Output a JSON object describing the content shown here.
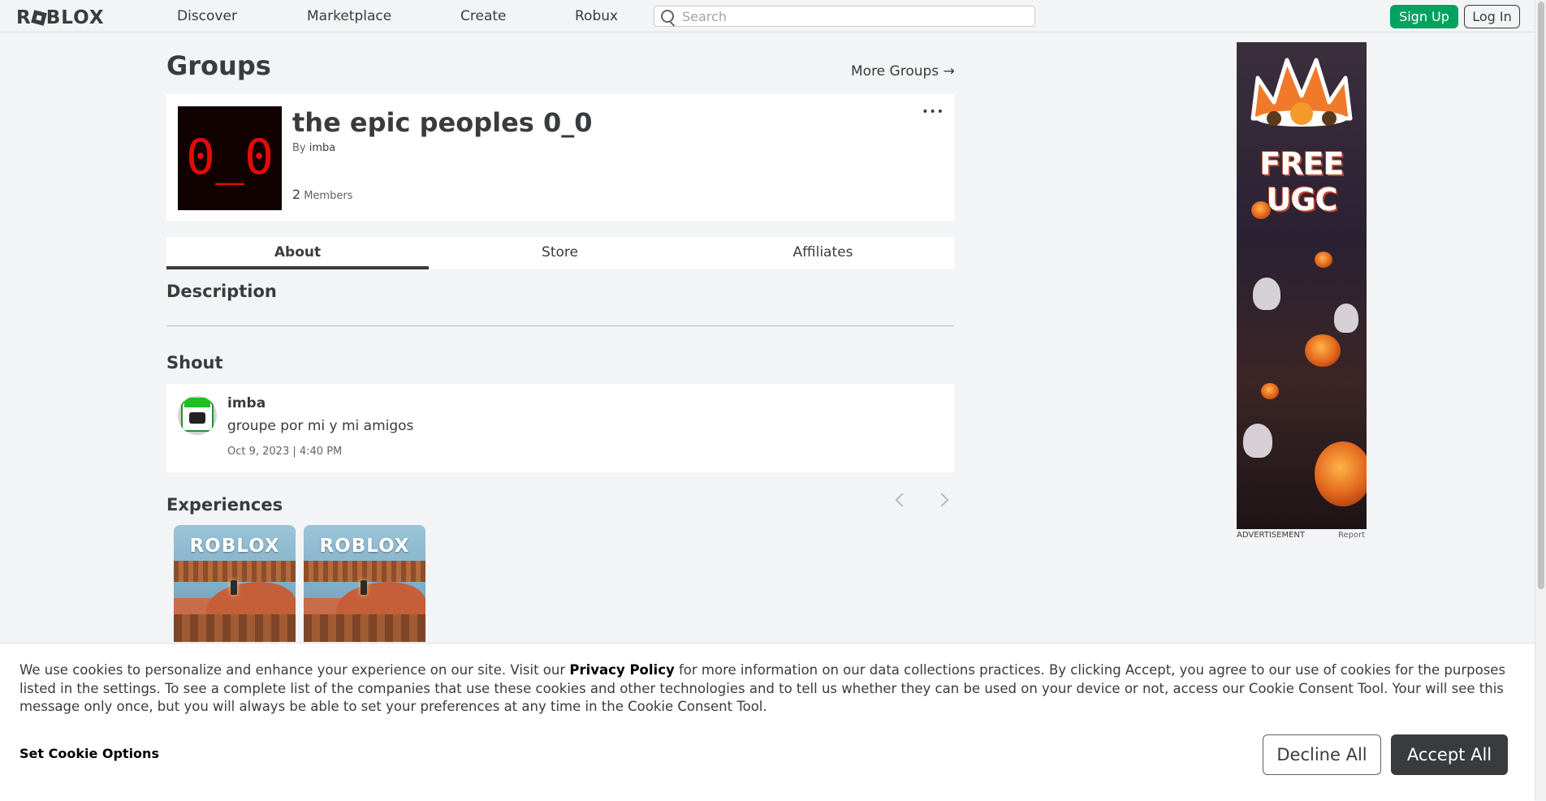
{
  "header": {
    "logo": "ROBLOX",
    "nav": [
      "Discover",
      "Marketplace",
      "Create",
      "Robux"
    ],
    "search_placeholder": "Search",
    "signup_label": "Sign Up",
    "login_label": "Log In"
  },
  "page": {
    "title": "Groups",
    "more_groups": "More Groups →"
  },
  "group": {
    "thumb_text": "0_0",
    "name": "the epic peoples 0_0",
    "by_prefix": "By",
    "owner": "imba",
    "member_count": "2",
    "member_label": "Members",
    "more_icon": "•••"
  },
  "tabs": [
    "About",
    "Store",
    "Affiliates"
  ],
  "description": {
    "heading": "Description"
  },
  "shout": {
    "heading": "Shout",
    "user": "imba",
    "text": "groupe por mi y mi amigos",
    "time": "Oct 9, 2023 | 4:40 PM"
  },
  "experiences": {
    "heading": "Experiences",
    "tiles": [
      "ROBLOX",
      "ROBLOX"
    ]
  },
  "ad": {
    "headline": "FREE UGC",
    "label": "ADVERTISEMENT",
    "report": "Report"
  },
  "cookie": {
    "text_1": "We use cookies to personalize and enhance your experience on our site. Visit our ",
    "privacy_link": "Privacy Policy",
    "text_2": " for more information on our data collections practices. By clicking Accept, you agree to our use of cookies for the purposes listed in the settings. To see a complete list of the companies that use these cookies and other technologies and to tell us whether they can be used on your device or not, access our Cookie Consent Tool. Your will see this message only once, but you will always be able to set your preferences at any time in the Cookie Consent Tool.",
    "options_label": "Set Cookie Options",
    "decline_label": "Decline All",
    "accept_label": "Accept All"
  },
  "colors": {
    "signup_green": "#00a260",
    "text_dark": "#393b3d",
    "background": "#f2f4f5",
    "group_thumb_text": "#e10b0b"
  }
}
